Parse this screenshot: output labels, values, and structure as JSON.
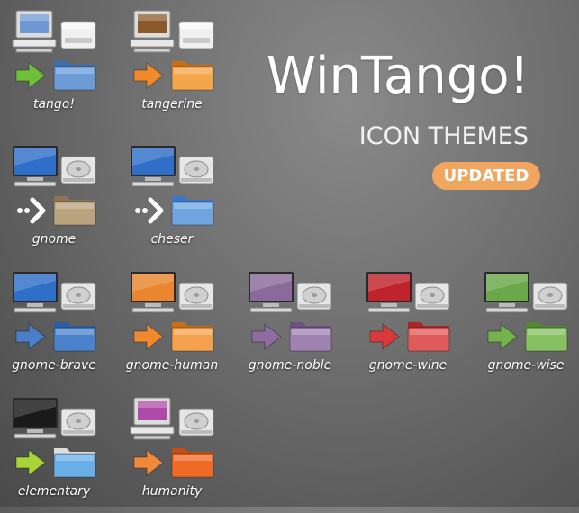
{
  "header": {
    "title": "WinTango!",
    "subtitle": "ICON THEMES",
    "badge": "UPDATED",
    "badge_color": "#f0a65e"
  },
  "themes": [
    {
      "label": "tango!",
      "monitor": "crt",
      "screen": "#6d98d4",
      "drive": "cabinet",
      "arrow": "#6ebf3a",
      "folder": "#6d9bd6",
      "tab": "#3a6fb0"
    },
    {
      "label": "tangerine",
      "monitor": "crt",
      "screen": "#8a5a2a",
      "drive": "cabinet",
      "arrow": "#f08a2c",
      "folder": "#f3a64a",
      "tab": "#c96d18"
    },
    {
      "label": "gnome",
      "monitor": "lcd",
      "screen": "#2f6fc8",
      "drive": "disk",
      "arrow": "#ffffff",
      "arrow_style": "dots",
      "folder": "#b9a27e",
      "tab": "#8a7454"
    },
    {
      "label": "cheser",
      "monitor": "lcd",
      "screen": "#2f6fc8",
      "drive": "disk",
      "arrow": "#ffffff",
      "arrow_style": "dots",
      "folder": "#6fa4e0",
      "tab": "#3b78c4"
    },
    {
      "label": "gnome-brave",
      "monitor": "lcd",
      "screen": "#2f6fc8",
      "drive": "disk",
      "arrow": "#4a7fc8",
      "folder": "#4a82cc",
      "tab": "#2c5fa2"
    },
    {
      "label": "gnome-human",
      "monitor": "lcd",
      "screen": "#e9862e",
      "drive": "disk",
      "arrow": "#f18a2e",
      "folder": "#f4a04c",
      "tab": "#c76e18"
    },
    {
      "label": "gnome-noble",
      "monitor": "lcd",
      "screen": "#8a6a9a",
      "drive": "disk",
      "arrow": "#8e6ba0",
      "folder": "#9f82b0",
      "tab": "#6e5080"
    },
    {
      "label": "gnome-wine",
      "monitor": "lcd",
      "screen": "#c0232c",
      "drive": "disk",
      "arrow": "#d83a3a",
      "folder": "#df5a5a",
      "tab": "#a82828"
    },
    {
      "label": "gnome-wise",
      "monitor": "lcd",
      "screen": "#6aa84a",
      "drive": "disk",
      "arrow": "#75b24e",
      "folder": "#86c060",
      "tab": "#4e8a32"
    },
    {
      "label": "elementary",
      "monitor": "lcd",
      "screen": "#1a1a1a",
      "drive": "disk",
      "arrow": "#a8d43a",
      "folder": "#6aaee8",
      "tab": "#dcdcdc"
    },
    {
      "label": "humanity",
      "monitor": "crt",
      "screen": "#b04aa8",
      "drive": "disk",
      "arrow": "#f08a3a",
      "folder": "#ef6a24",
      "tab": "#c44e14"
    }
  ]
}
